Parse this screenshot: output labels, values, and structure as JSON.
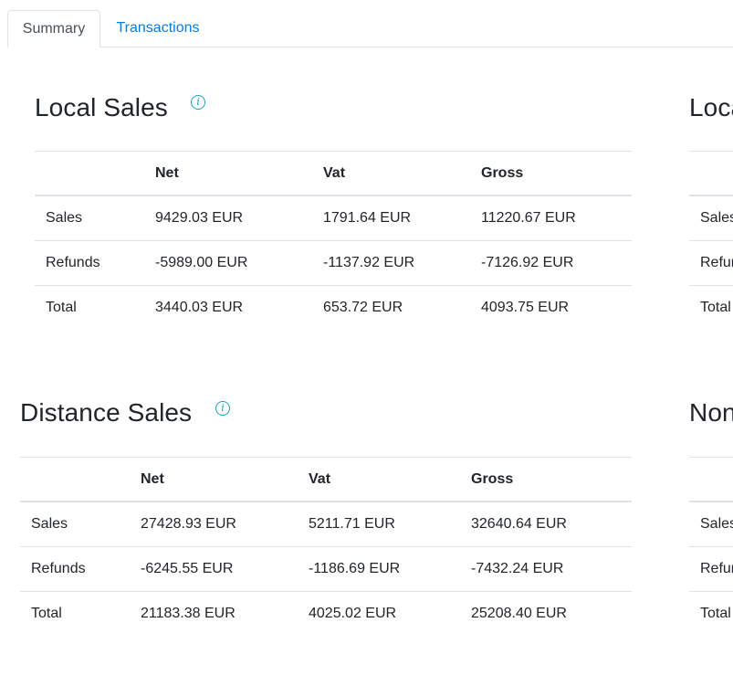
{
  "tabs": [
    {
      "label": "Summary",
      "active": true
    },
    {
      "label": "Transactions",
      "active": false
    }
  ],
  "info_icon_glyph": "i",
  "colors": {
    "link": "#0a7bdb",
    "info": "#17a2b8",
    "border": "#dee2e6"
  },
  "local_sales": {
    "title": "Local Sales",
    "headers": [
      "",
      "Net",
      "Vat",
      "Gross"
    ],
    "rows": [
      {
        "label": "Sales",
        "net": "9429.03 EUR",
        "vat": "1791.64 EUR",
        "gross": "11220.67 EUR"
      },
      {
        "label": "Refunds",
        "net": "-5989.00 EUR",
        "vat": "-1137.92 EUR",
        "gross": "-7126.92 EUR"
      },
      {
        "label": "Total",
        "net": "3440.03 EUR",
        "vat": "653.72 EUR",
        "gross": "4093.75 EUR"
      }
    ]
  },
  "distance_sales": {
    "title": "Distance Sales",
    "headers": [
      "",
      "Net",
      "Vat",
      "Gross"
    ],
    "rows": [
      {
        "label": "Sales",
        "net": "27428.93 EUR",
        "vat": "5211.71 EUR",
        "gross": "32640.64 EUR"
      },
      {
        "label": "Refunds",
        "net": "-6245.55 EUR",
        "vat": "-1186.69 EUR",
        "gross": "-7432.24 EUR"
      },
      {
        "label": "Total",
        "net": "21183.38 EUR",
        "vat": "4025.02 EUR",
        "gross": "25208.40 EUR"
      }
    ]
  },
  "right_top_partial": {
    "title": "Loca",
    "rows": [
      "Sales",
      "Refun",
      "Total"
    ]
  },
  "right_bottom_partial": {
    "title": "Non",
    "rows": [
      "Sales",
      "Refun",
      "Total"
    ]
  }
}
